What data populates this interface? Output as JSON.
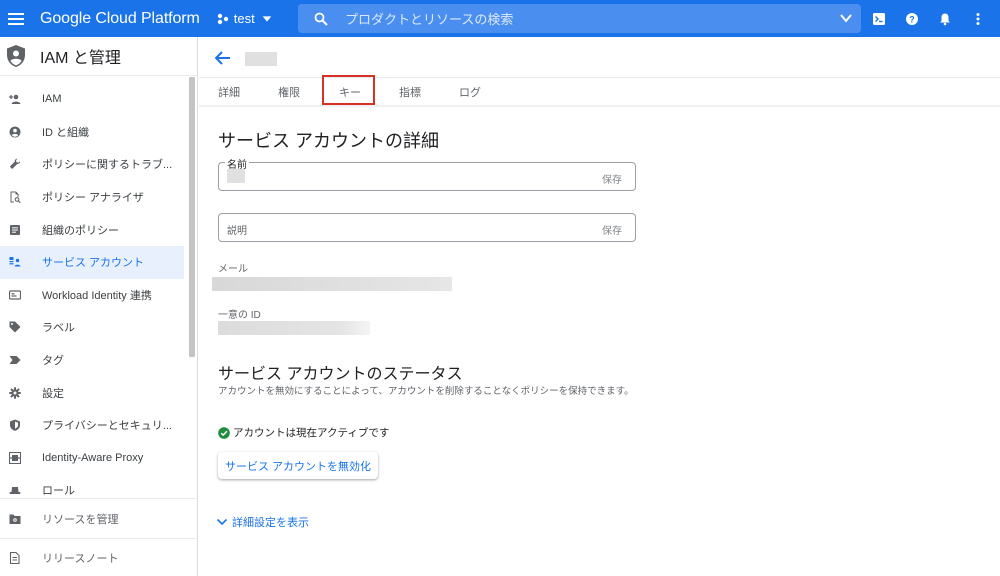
{
  "topbar": {
    "brand": "Google Cloud Platform",
    "project": "test",
    "search_placeholder": "プロダクトとリソースの検索"
  },
  "sidebar": {
    "title": "IAM と管理",
    "items": [
      {
        "label": "IAM",
        "icon": "person-add-icon"
      },
      {
        "label": "ID と組織",
        "icon": "account-circle-icon"
      },
      {
        "label": "ポリシーに関するトラブ...",
        "icon": "wrench-icon"
      },
      {
        "label": "ポリシー アナライザ",
        "icon": "document-search-icon"
      },
      {
        "label": "組織のポリシー",
        "icon": "list-document-icon"
      },
      {
        "label": "サービス アカウント",
        "icon": "service-account-icon"
      },
      {
        "label": "Workload Identity 連携",
        "icon": "id-card-icon"
      },
      {
        "label": "ラベル",
        "icon": "tag-icon"
      },
      {
        "label": "タグ",
        "icon": "tag-arrow-icon"
      },
      {
        "label": "設定",
        "icon": "gear-icon"
      },
      {
        "label": "プライバシーとセキュリ...",
        "icon": "shield-icon"
      },
      {
        "label": "Identity-Aware Proxy",
        "icon": "proxy-icon"
      },
      {
        "label": "ロール",
        "icon": "hat-icon"
      }
    ],
    "active_index": 5,
    "manage_resources": "リソースを管理",
    "release_notes": "リリースノート"
  },
  "main": {
    "tabs": [
      "詳細",
      "権限",
      "キー",
      "指標",
      "ログ"
    ],
    "heading": "サービス アカウントの詳細",
    "name_label": "名前",
    "save": "保存",
    "description_placeholder": "説明",
    "email_label": "メール",
    "unique_id_label": "一意の ID",
    "status_heading": "サービス アカウントのステータス",
    "status_description": "アカウントを無効にすることによって、アカウントを削除することなくポリシーを保持できます。",
    "status_text": "アカウントは現在アクティブです",
    "disable_button": "サービス アカウントを無効化",
    "advanced_link": "詳細設定を表示"
  },
  "colors": {
    "accent": "#1a73e8",
    "highlight_box": "#d93025",
    "active_status": "#1e8e3e"
  }
}
